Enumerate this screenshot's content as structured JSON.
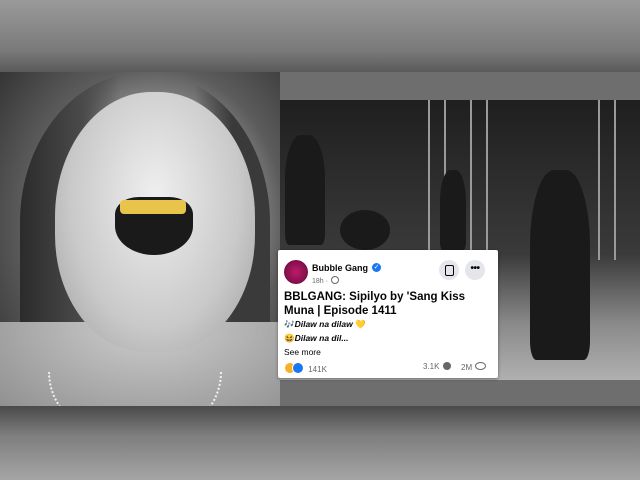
{
  "post": {
    "page_name": "Bubble Gang",
    "time": "18h",
    "title": "BBLGANG: Sipilyo by 'Sang Kiss Muna | Episode 1411",
    "line1": "Dilaw na dilaw",
    "line1_prefix_emoji": "🎶",
    "line1_suffix_emoji": "💛",
    "line2": "Dilaw na dil...",
    "line2_prefix_emoji": "😆",
    "see_more": "See more",
    "reactions_count": "141K",
    "comments_count": "3.1K",
    "views_count": "2M"
  },
  "icons": {
    "verified": "verified-badge-icon",
    "globe": "globe-icon",
    "save": "save-icon",
    "more": "more-options-icon",
    "more_glyph": "•••",
    "reaction_haha": "haha-reaction-icon",
    "reaction_like": "like-reaction-icon",
    "comment": "comment-icon",
    "views": "eye-icon",
    "verified_glyph": "✓"
  },
  "colors": {
    "accent": "#1877f2",
    "teeth": "#e8c44a",
    "text": "#050505",
    "meta": "#65676b"
  }
}
